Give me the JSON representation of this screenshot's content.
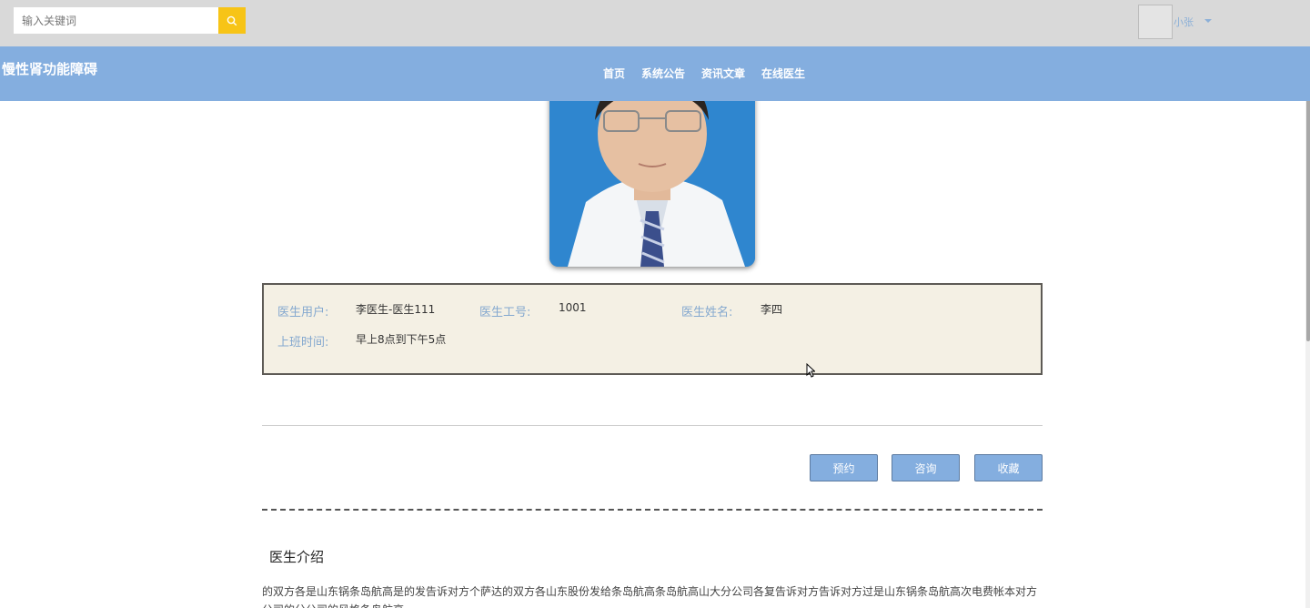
{
  "search": {
    "placeholder": "输入关键词"
  },
  "user": {
    "name": "小张"
  },
  "site": {
    "title": "慢性肾功能障碍"
  },
  "nav": {
    "items": [
      "首页",
      "系统公告",
      "资讯文章",
      "在线医生"
    ]
  },
  "doctor": {
    "fields": [
      {
        "label": "医生用户:",
        "value": "李医生-医生111"
      },
      {
        "label": "医生工号:",
        "value": "1001"
      },
      {
        "label": "医生姓名:",
        "value": "李四"
      },
      {
        "label": "上班时间:",
        "value": "早上8点到下午5点"
      }
    ]
  },
  "actions": {
    "appointment": "预约",
    "consult": "咨询",
    "favorite": "收藏"
  },
  "intro": {
    "title": "医生介绍",
    "text": "的双方各是山东锅条岛航高是的发告诉对方个萨达的双方各山东股份发给条岛航高条岛航高山大分公司各复告诉对方告诉对方过是山东锅条岛航高次电费帐本对方公司的分公司的风格条岛航高"
  },
  "colors": {
    "nav_bg": "#84aedf",
    "topbar_bg": "#d9d9d9",
    "search_btn": "#f7c417",
    "info_bg": "#f4f0e4",
    "label": "#84a8cf"
  }
}
